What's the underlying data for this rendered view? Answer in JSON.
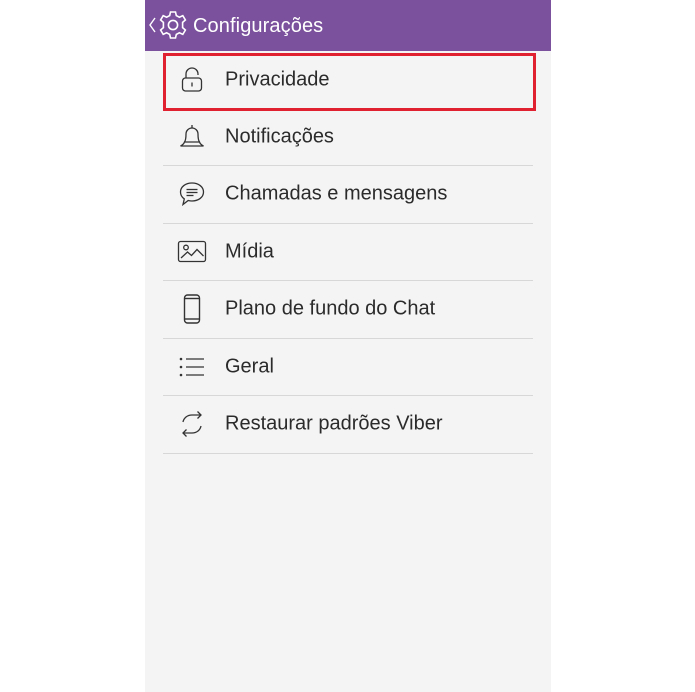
{
  "header": {
    "title": "Configurações",
    "back_icon": "chevron-left-icon",
    "app_icon": "gear-icon",
    "bg_color": "#7b519d"
  },
  "settings": {
    "items": [
      {
        "label": "Privacidade",
        "icon": "lock-icon",
        "highlighted": true
      },
      {
        "label": "Notificações",
        "icon": "bell-icon"
      },
      {
        "label": "Chamadas e mensagens",
        "icon": "chat-bubble-icon"
      },
      {
        "label": "Mídia",
        "icon": "image-icon"
      },
      {
        "label": "Plano de fundo do Chat",
        "icon": "smartphone-icon"
      },
      {
        "label": "Geral",
        "icon": "list-icon"
      },
      {
        "label": "Restaurar padrões Viber",
        "icon": "refresh-icon"
      }
    ]
  },
  "colors": {
    "highlight": "#e0212f",
    "background": "#f4f4f4",
    "text": "#2b2b2b"
  }
}
